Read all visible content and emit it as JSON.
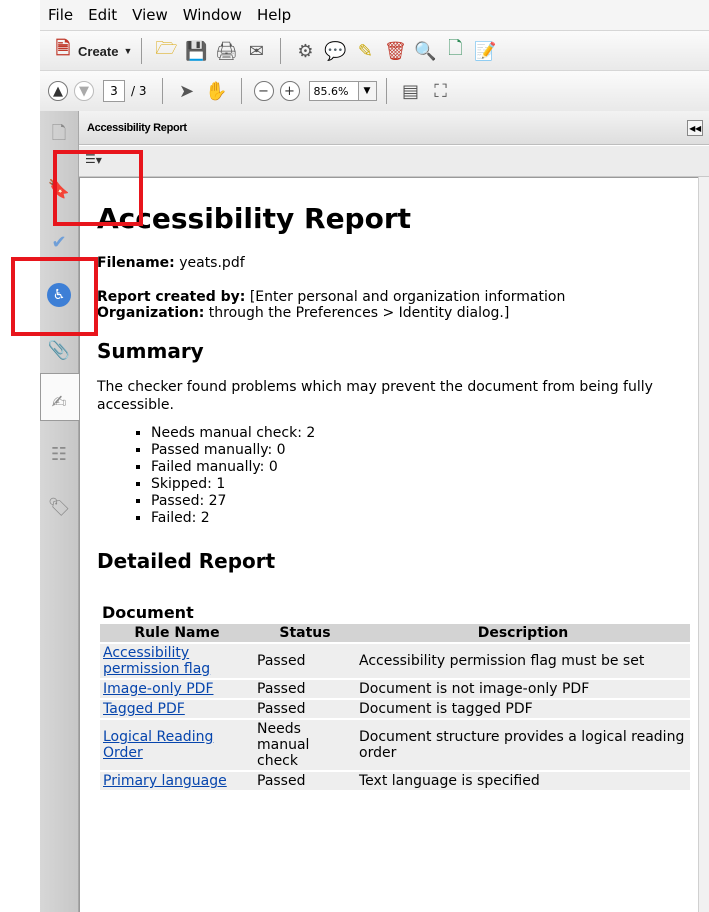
{
  "menu": [
    "File",
    "Edit",
    "View",
    "Window",
    "Help"
  ],
  "toolbar": {
    "create_label": "Create",
    "page_current": "3",
    "page_total": "/ 3",
    "zoom": "85.6%"
  },
  "panel": {
    "title": "Accessibility Report"
  },
  "report": {
    "title": "Accessibility Report",
    "filename_label": "Filename:",
    "filename": "yeats.pdf",
    "created_label": "Report created by:",
    "created_value": "[Enter personal and organization information",
    "org_label": "Organization:",
    "org_value": "through the Preferences > Identity dialog.]",
    "summary_heading": "Summary",
    "summary_text": "The checker found problems which may prevent the document from being fully accessible.",
    "summary_items": [
      "Needs manual check: 2",
      "Passed manually: 0",
      "Failed manually: 0",
      "Skipped: 1",
      "Passed: 27",
      "Failed: 2"
    ],
    "detailed_heading": "Detailed Report",
    "table_caption": "Document",
    "table_headers": [
      "Rule Name",
      "Status",
      "Description"
    ],
    "rows": [
      {
        "rule": "Accessibility permission flag",
        "status": "Passed",
        "desc": "Accessibility permission flag must be set"
      },
      {
        "rule": "Image-only PDF",
        "status": "Passed",
        "desc": "Document is not image-only PDF"
      },
      {
        "rule": "Tagged PDF",
        "status": "Passed",
        "desc": "Document is tagged PDF"
      },
      {
        "rule": "Logical Reading Order",
        "status": "Needs manual check",
        "desc": "Document structure provides a logical reading order"
      },
      {
        "rule": "Primary language",
        "status": "Passed",
        "desc": "Text language is specified"
      }
    ]
  },
  "colors": {
    "highlight": "#e8151c",
    "link": "#0645ad"
  }
}
